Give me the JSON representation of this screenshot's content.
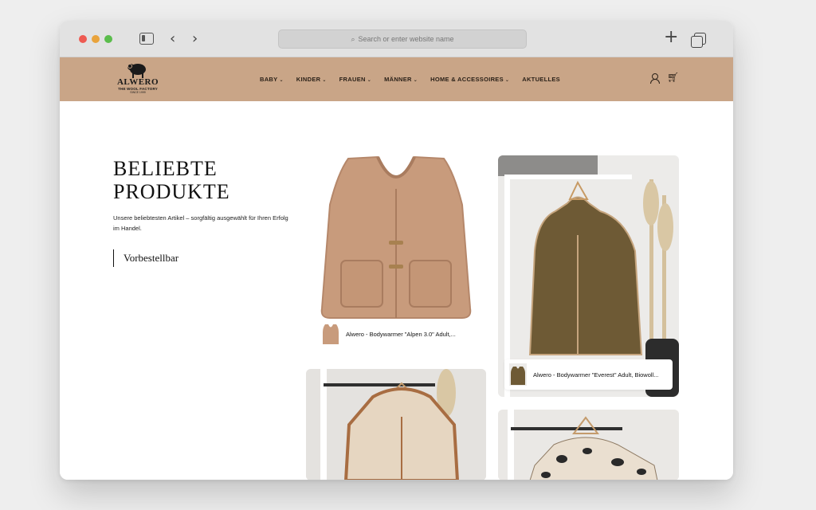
{
  "browser": {
    "url_placeholder": "Search or enter website name",
    "back_label": "‹",
    "forward_label": "›",
    "new_tab_label": "+"
  },
  "brand": {
    "name": "ALWERO",
    "tagline": "THE WOOL FACTORY",
    "since": "SINCE 1999",
    "header_color": "#c9a587"
  },
  "nav": {
    "items": [
      {
        "label": "BABY",
        "has_dropdown": true
      },
      {
        "label": "KINDER",
        "has_dropdown": true
      },
      {
        "label": "FRAUEN",
        "has_dropdown": true
      },
      {
        "label": "MÄNNER",
        "has_dropdown": true
      },
      {
        "label": "HOME & ACCESSOIRES",
        "has_dropdown": true
      },
      {
        "label": "AKTUELLES",
        "has_dropdown": false
      }
    ],
    "chevron": "⌄",
    "icons": [
      "user-icon",
      "cart-icon"
    ]
  },
  "hero": {
    "title_line1": "BELIEBTE",
    "title_line2": "PRODUKTE",
    "subtitle": "Unsere beliebtesten Artikel – sorgfältig ausgewählt für Ihren Erfolg im Handel.",
    "cta": "Vorbestellbar"
  },
  "products": [
    {
      "title": "Alwero - Bodywarmer \"Alpen 3.0\" Adult,...",
      "color": "#c89b7c"
    },
    {
      "title": "Alwero - Bodywarmer \"Everest\" Adult, Biowoll...",
      "color": "#6e5a35"
    },
    {
      "title": "",
      "color": "#e6d6c1"
    },
    {
      "title": "",
      "color": "#eadfd0"
    }
  ]
}
